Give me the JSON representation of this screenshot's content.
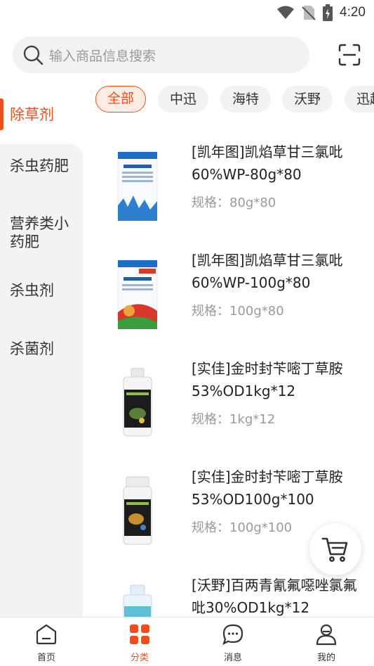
{
  "status_bar": {
    "time": "4:20"
  },
  "search": {
    "placeholder": "输入商品信息搜索"
  },
  "sidebar": {
    "items": [
      {
        "label": "除草剂",
        "active": true
      },
      {
        "label": "杀虫药肥"
      },
      {
        "label": "营养类小药肥"
      },
      {
        "label": "杀虫剂"
      },
      {
        "label": "杀菌剂"
      }
    ]
  },
  "brand_chips": [
    {
      "label": "全部",
      "active": true
    },
    {
      "label": "中迅"
    },
    {
      "label": "海特"
    },
    {
      "label": "沃野"
    },
    {
      "label": "迅超"
    }
  ],
  "products": [
    {
      "title": "[凯年图]凯焰草甘三氯吡60%WP-80g*80",
      "spec": "规格：80g*80"
    },
    {
      "title": "[凯年图]凯焰草甘三氯吡60%WP-100g*80",
      "spec": "规格：100g*80"
    },
    {
      "title": "[实佳]金时封苄嘧丁草胺53%OD1kg*12",
      "spec": "规格：1kg*12"
    },
    {
      "title": "[实佳]金时封苄嘧丁草胺53%OD100g*100",
      "spec": "规格：100g*100"
    },
    {
      "title": "[沃野]百两青氰氟噁唑氯氟吡30%OD1kg*12",
      "spec": ""
    }
  ],
  "tabbar": {
    "items": [
      {
        "label": "首页",
        "icon": "home-icon"
      },
      {
        "label": "分类",
        "icon": "category-icon",
        "active": true
      },
      {
        "label": "消息",
        "icon": "message-icon"
      },
      {
        "label": "我的",
        "icon": "profile-icon"
      }
    ]
  },
  "colors": {
    "accent": "#f04e1e",
    "sidebar_bg": "#f3f3f3",
    "chip_bg": "#f2f2f2"
  }
}
